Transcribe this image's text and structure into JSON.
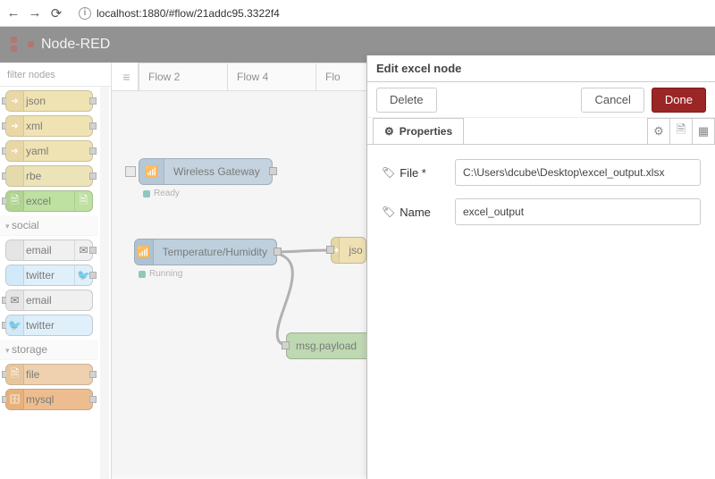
{
  "browser": {
    "url": "localhost:1880/#flow/21addc95.3322f4"
  },
  "header": {
    "title": "Node-RED"
  },
  "palette": {
    "filter_placeholder": "filter nodes",
    "groups": [
      {
        "nodes": [
          {
            "label": "json",
            "cls": "c-parse"
          },
          {
            "label": "xml",
            "cls": "c-parse"
          },
          {
            "label": "yaml",
            "cls": "c-parse"
          },
          {
            "label": "rbe",
            "cls": "c-rbe"
          },
          {
            "label": "excel",
            "cls": "c-excel"
          }
        ]
      },
      {
        "title": "social",
        "nodes": [
          {
            "label": "email",
            "cls": "c-email"
          },
          {
            "label": "twitter",
            "cls": "c-twitter"
          },
          {
            "label": "email",
            "cls": "c-email"
          },
          {
            "label": "twitter",
            "cls": "c-twitter"
          }
        ]
      },
      {
        "title": "storage",
        "nodes": [
          {
            "label": "file",
            "cls": "c-file"
          },
          {
            "label": "mysql",
            "cls": "c-mysql"
          }
        ]
      }
    ]
  },
  "tabs": {
    "items": [
      "Flow 2",
      "Flow 4",
      "Flo"
    ]
  },
  "flow": {
    "gateway": {
      "label": "Wireless Gateway",
      "status": "Ready"
    },
    "temphum": {
      "label": "Temperature/Humidity",
      "status": "Running"
    },
    "json": {
      "label": "jso"
    },
    "debug": {
      "label": "msg.payload"
    }
  },
  "tray": {
    "title": "Edit excel node",
    "delete": "Delete",
    "cancel": "Cancel",
    "done": "Done",
    "tab_properties": "Properties",
    "file_label": "File *",
    "file_value": "C:\\Users\\dcube\\Desktop\\excel_output.xlsx",
    "name_label": "Name",
    "name_value": "excel_output"
  }
}
